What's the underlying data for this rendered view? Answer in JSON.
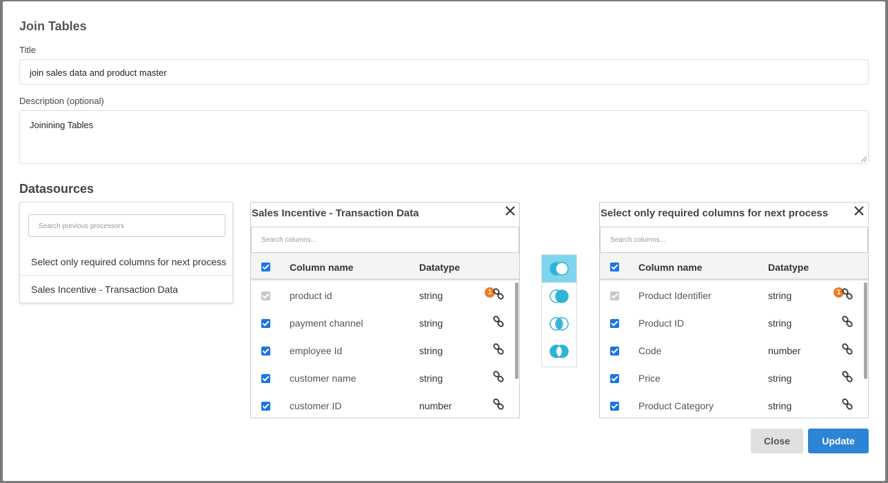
{
  "modal": {
    "heading": "Join Tables",
    "title_label": "Title",
    "title_value": "join sales data and product master",
    "description_label": "Description (optional)",
    "description_value": "Joinining Tables",
    "datasources_heading": "Datasources"
  },
  "processors": {
    "search_placeholder": "Search previous processors",
    "items": [
      {
        "label": "Select only required columns for next process"
      },
      {
        "label": "Sales Incentive - Transaction Data"
      }
    ]
  },
  "left_table": {
    "title": "Sales Incentive - Transaction Data",
    "search_placeholder": "Search columns...",
    "col_name_header": "Column name",
    "col_type_header": "Datatype",
    "rows": [
      {
        "name": "product id",
        "type": "string",
        "checked": true,
        "disabled": true,
        "badge": "1"
      },
      {
        "name": "payment channel",
        "type": "string",
        "checked": true
      },
      {
        "name": "employee Id",
        "type": "string",
        "checked": true
      },
      {
        "name": "customer name",
        "type": "string",
        "checked": true
      },
      {
        "name": "customer ID",
        "type": "number",
        "checked": true
      }
    ]
  },
  "right_table": {
    "title": "Select only required columns for next process",
    "search_placeholder": "Search columns...",
    "col_name_header": "Column name",
    "col_type_header": "Datatype",
    "rows": [
      {
        "name": "Product Identifier",
        "type": "string",
        "checked": true,
        "disabled": true,
        "badge": "1"
      },
      {
        "name": "Product ID",
        "type": "string",
        "checked": true
      },
      {
        "name": "Code",
        "type": "number",
        "checked": true
      },
      {
        "name": "Price",
        "type": "string",
        "checked": true
      },
      {
        "name": "Product Category",
        "type": "string",
        "checked": true
      }
    ]
  },
  "join_types": {
    "options": [
      "left-join-icon",
      "right-join-icon",
      "inner-join-icon",
      "full-outer-join-icon"
    ],
    "selected": "left-join-icon",
    "accent_color": "#2fb3d9",
    "active_bg": "#7fd4ee"
  },
  "actions": {
    "close_label": "Close",
    "update_label": "Update"
  },
  "colors": {
    "primary": "#2b85d4",
    "badge": "#f07b1f",
    "checkbox": "#1a73e8"
  }
}
